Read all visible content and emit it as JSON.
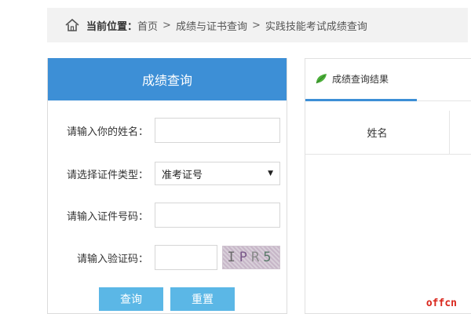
{
  "breadcrumb": {
    "lead": "当前位置：",
    "items": [
      "首页",
      "成绩与证书查询",
      "实践技能考试成绩查询"
    ],
    "separator": ">"
  },
  "left_panel": {
    "title": "成绩查询",
    "name_label": "请输入你的姓名：",
    "name_value": "",
    "id_type_label": "请选择证件类型：",
    "id_type_selected": "准考证号",
    "id_number_label": "请输入证件号码：",
    "id_number_value": "",
    "captcha_label": "请输入验证码：",
    "captcha_value": "",
    "captcha_chars": [
      "I",
      "P",
      "R",
      "5"
    ],
    "query_button": "查询",
    "reset_button": "重置"
  },
  "right_panel": {
    "tab_label": "成绩查询结果",
    "columns": [
      "姓名"
    ]
  },
  "watermark": "offcn",
  "colors": {
    "primary": "#3d8fd6",
    "button": "#5bb7e6",
    "watermark": "#d9261c"
  }
}
